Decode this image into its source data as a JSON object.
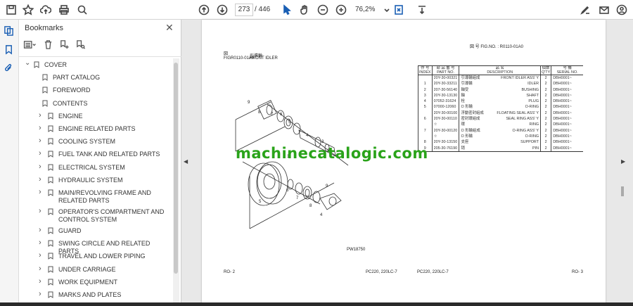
{
  "toolbar": {
    "page_current": "273",
    "page_total": "/ 446",
    "zoom": "76,2%"
  },
  "bookmarks_panel": {
    "title": "Bookmarks",
    "items": [
      {
        "label": "COVER",
        "level": 0,
        "expanded": true
      },
      {
        "label": "PART CATALOG",
        "level": 1
      },
      {
        "label": "FOREWORD",
        "level": 1
      },
      {
        "label": "CONTENTS",
        "level": 1,
        "expanded": true
      },
      {
        "label": "ENGINE",
        "level": 2
      },
      {
        "label": "ENGINE RELATED PARTS",
        "level": 2
      },
      {
        "label": "COOLING SYSTEM",
        "level": 2
      },
      {
        "label": "FUEL TANK AND RELATED PARTS",
        "level": 2
      },
      {
        "label": "ELECTRICAL SYSTEM",
        "level": 2
      },
      {
        "label": "HYDRAULIC SYSTEM",
        "level": 2
      },
      {
        "label": "MAIN/REVOLVING FRAME AND RELATED PARTS",
        "level": 2
      },
      {
        "label": "OPERATOR'S COMPARTMENT AND CONTROL SYSTEM",
        "level": 2
      },
      {
        "label": "GUARD",
        "level": 2
      },
      {
        "label": "SWING CIRCLE AND RELATED PARTS",
        "level": 2
      },
      {
        "label": "TRAVEL AND LOWER PIPING",
        "level": 2
      },
      {
        "label": "UNDER CARRIAGE",
        "level": 2
      },
      {
        "label": "WORK EQUIPMENT",
        "level": 2
      },
      {
        "label": "MARKS AND PLATES",
        "level": 2
      }
    ]
  },
  "document": {
    "left": {
      "fig_label": "図\nFIG.",
      "fig_no": "R0110-01A0",
      "fig_title_jp": "引導輪",
      "fig_title_en": "FRONT IDLER",
      "drawing_code": "PW18750",
      "footer_left": "RO- 2",
      "footer_right": "PC220, 220LC-7"
    },
    "right": {
      "fig_header": "図 号  FIG.NO. : R0110-01A0",
      "columns": [
        {
          "jp": "作 号",
          "en": "INDEX"
        },
        {
          "jp": "部 品 番 号",
          "en": "PART NO."
        },
        {
          "jp": "品   名",
          "en": "DESCRIPTION"
        },
        {
          "jp": "個数",
          "en": "Q'TY"
        },
        {
          "jp": "号 機",
          "en": "SERIAL NO."
        }
      ],
      "rows": [
        {
          "idx": "",
          "part": "20Y-30-00321",
          "jp": "引導輪組成",
          "desc": "FRONT IDLER ASS' Y",
          "qty": "2",
          "serial": "DBH0001~"
        },
        {
          "idx": "1",
          "part": "20Y-30-33211",
          "jp": "引導輪",
          "desc": "IDLER",
          "qty": "2",
          "serial": "DBH0001~"
        },
        {
          "idx": "2",
          "part": "207-30-56140",
          "jp": "軸受",
          "desc": "BUSHING",
          "qty": "2",
          "serial": "DBH0001~"
        },
        {
          "idx": "3",
          "part": "20Y-30-13130",
          "jp": "軸",
          "desc": "SHAFT",
          "qty": "2",
          "serial": "DBH0001~"
        },
        {
          "idx": "4",
          "part": "07052-31624",
          "jp": "栓",
          "desc": "PLUG",
          "qty": "2",
          "serial": "DBH0001~"
        },
        {
          "idx": "5",
          "part": "07000-12060",
          "jp": "O 形輪",
          "desc": "O-RING",
          "qty": "2",
          "serial": "DBH0001~"
        },
        {
          "idx": "",
          "part": "20Y-30-00100",
          "jp": "浮動密封組成",
          "desc": "FLOATING SEAL ASS' Y",
          "qty": "2",
          "serial": "DBH0001~"
        },
        {
          "idx": "6",
          "part": "20Y-30-00110",
          "jp": "密封環組成",
          "desc": "SEAL RING ASS' Y",
          "qty": "2",
          "serial": "DBH0001~"
        },
        {
          "idx": "",
          "part": "☆",
          "jp": "環",
          "desc": "RING",
          "qty": "2",
          "serial": "DBH0001~"
        },
        {
          "idx": "7",
          "part": "20Y-30-00120",
          "jp": "O 形輪組成",
          "desc": "O-RING ASS' Y",
          "qty": "2",
          "serial": "DBH0001~"
        },
        {
          "idx": "",
          "part": "☆",
          "jp": "O 形輪",
          "desc": "O-RING",
          "qty": "2",
          "serial": "DBH0001~"
        },
        {
          "idx": "8",
          "part": "20Y-30-13150",
          "jp": "支座",
          "desc": "SUPPORT",
          "qty": "2",
          "serial": "DBH0001~"
        },
        {
          "idx": "9",
          "part": "205-30-76190",
          "jp": "销",
          "desc": "PIN",
          "qty": "2",
          "serial": "DBH0001~"
        }
      ],
      "footer_left": "PC220, 220LC-7",
      "footer_right": "RO- 3"
    },
    "watermark": "machinecatalogic.com"
  },
  "callouts": [
    "9",
    "8",
    "7",
    "6",
    "5",
    "4",
    "3",
    "2",
    "1",
    "6",
    "7",
    "8",
    "9",
    "4",
    "5"
  ]
}
